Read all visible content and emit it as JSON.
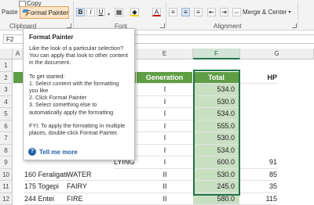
{
  "ribbon": {
    "paste_label": "Paste",
    "copy_label": "Copy",
    "format_painter_label": "Format Painter",
    "bold": "B",
    "italic": "I",
    "underline": "U",
    "merge_center_label": "Merge & Center",
    "groups": {
      "clipboard": "Clipboard",
      "font": "Font",
      "alignment": "Alignment"
    }
  },
  "formula_bar": {
    "name_box": "F2",
    "content": "Total"
  },
  "columns": {
    "a": "A",
    "e": "E",
    "f": "F",
    "g": "G"
  },
  "rows": [
    "1",
    "2",
    "3",
    "4",
    "5",
    "6",
    "7",
    "8",
    "9",
    "10",
    "11",
    "12"
  ],
  "table": {
    "header": {
      "generation": "Generation",
      "total": "Total",
      "hp": "HP"
    },
    "partial_names": [
      "G",
      "",
      "",
      "",
      "",
      "",
      "LYING"
    ],
    "visible_rows": [
      {
        "gen": "I",
        "total": "534.0"
      },
      {
        "gen": "I",
        "total": "530.0"
      },
      {
        "gen": "I",
        "total": "534.0"
      },
      {
        "gen": "I",
        "total": "555.0"
      },
      {
        "gen": "I",
        "total": "530.0"
      },
      {
        "gen": "I",
        "total": "534.0"
      },
      {
        "gen": "I",
        "total": "600.0",
        "hp": "91"
      },
      {
        "name": "160 Feraligatr",
        "type": "WATER",
        "gen": "II",
        "total": "530.0",
        "hp": "85"
      },
      {
        "name": "175 Togepi",
        "type": "FAIRY",
        "gen": "II",
        "total": "245.0",
        "hp": "35"
      },
      {
        "name": "244 Entei",
        "type": "FIRE",
        "gen": "II",
        "total": "580.0",
        "hp": "115"
      },
      {
        "name": "258 Mudkip",
        "type": "WATER",
        "gen": "III",
        "total": "310.0",
        "hp": "50"
      }
    ]
  },
  "tooltip": {
    "title": "Format Painter",
    "intro": "Like the look of a particular selection? You can apply that look to other content in the document.",
    "get_started": "To get started:",
    "step1": "1. Select content with the formatting you like",
    "step2": "2. Click Format Painter",
    "step3": "3. Select something else to automatically apply the formatting",
    "fyi": "FYI: To apply the formatting in multiple places, double-click Format Painter.",
    "tell_me_more": "Tell me more"
  },
  "colors": {
    "header_green": "#5f9e45",
    "total_fill": "#c9dfc2",
    "selection": "#217346",
    "format_painter_highlight": "#fde6c7"
  }
}
